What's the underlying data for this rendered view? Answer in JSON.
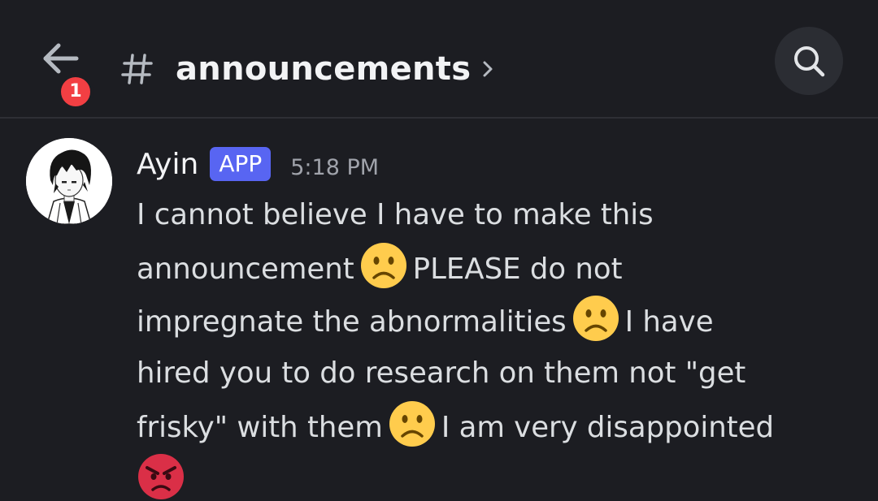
{
  "header": {
    "notification_count": "1",
    "channel_hash": "#",
    "channel_name": "announcements"
  },
  "message": {
    "author": "Ayin",
    "tag": "APP",
    "timestamp": "5:18 PM",
    "lines": [
      [
        "I cannot believe I have to make this"
      ],
      [
        "announcement",
        "PLEASE do not"
      ],
      [
        "impregnate the abnormalities",
        "I have"
      ],
      [
        "hired you to do research on them not \"get"
      ],
      [
        "frisky\" with them",
        "I am very disappointed"
      ]
    ],
    "emojis": [
      "frowning-face",
      "frowning-face",
      "frowning-face",
      "angry-face"
    ]
  },
  "colors": {
    "background": "#1c1d22",
    "accent": "#5865f2",
    "badge": "#f23f43",
    "emoji_yellow": "#ffcc4d",
    "emoji_red": "#da2f47"
  }
}
